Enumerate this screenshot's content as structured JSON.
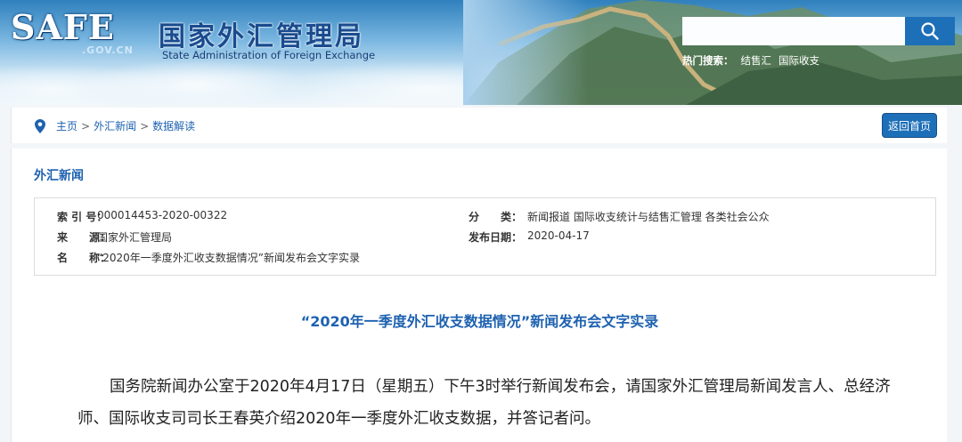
{
  "header": {
    "logo_text": "SAFE",
    "domain_text": ".GOV.CN",
    "title_cn": "国家外汇管理局",
    "title_en": "State Administration of Foreign Exchange",
    "search": {
      "value": "",
      "placeholder": ""
    },
    "hot_label": "热门搜索：",
    "hot_items": [
      "结售汇",
      "国际收支"
    ]
  },
  "breadcrumb": {
    "items": [
      "主页",
      "外汇新闻",
      "数据解读"
    ],
    "separator": ">",
    "back_label": "返回首页"
  },
  "section_title": "外汇新闻",
  "meta": {
    "index_label": "索 引 号：",
    "index_value": "000014453-2020-00322",
    "category_label": "分　　类：",
    "category_value": "新闻报道  国际收支统计与结售汇管理  各类社会公众",
    "source_label": "来　　源：",
    "source_value": "国家外汇管理局",
    "date_label": "发布日期：",
    "date_value": "2020-04-17",
    "name_label": "名　　称：",
    "name_value": "“2020年一季度外汇收支数据情况”新闻发布会文字实录"
  },
  "article": {
    "headline": "“2020年一季度外汇收支数据情况”新闻发布会文字实录",
    "paragraph": "国务院新闻办公室于2020年4月17日（星期五）下午3时举行新闻发布会，请国家外汇管理局新闻发言人、总经济师、国际收支司司长王春英介绍2020年一季度外汇收支数据，并答记者问。"
  },
  "colors": {
    "brand_blue": "#1d6fb8",
    "link_blue": "#1e62b0"
  },
  "icons": {
    "search": "search-icon",
    "location": "location-pin-icon"
  }
}
